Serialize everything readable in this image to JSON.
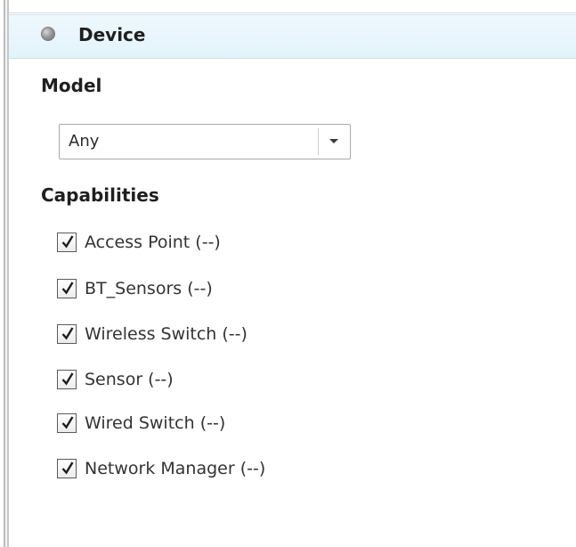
{
  "section": {
    "title": "Device",
    "indicator_color": "#8e8e8e",
    "header_background": "#e6f4fb"
  },
  "model": {
    "label": "Model",
    "selected": "Any"
  },
  "capabilities": {
    "label": "Capabilities",
    "items": [
      {
        "label": "Access Point (--)",
        "checked": true
      },
      {
        "label": "BT_Sensors (--)",
        "checked": true
      },
      {
        "label": "Wireless Switch (--)",
        "checked": true
      },
      {
        "label": "Sensor (--)",
        "checked": true
      },
      {
        "label": "Wired Switch (--)",
        "checked": true
      },
      {
        "label": "Network Manager (--)",
        "checked": true
      }
    ]
  }
}
